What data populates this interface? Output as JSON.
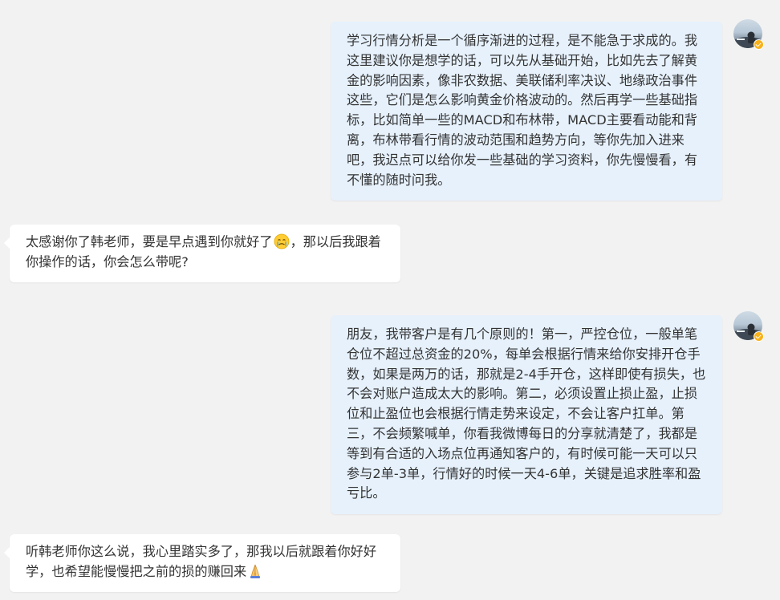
{
  "messages": [
    {
      "side": "out",
      "text": "学习行情分析是一个循序渐进的过程，是不能急于求成的。我这里建议你是想学的话，可以先从基础开始，比如先去了解黄金的影响因素，像非农数据、美联储利率决议、地缘政治事件这些，它们是怎么影响黄金价格波动的。然后再学一些基础指标，比如简单一些的MACD和布林带，MACD主要看动能和背离，布林带看行情的波动范围和趋势方向，等你先加入进来吧，我迟点可以给你发一些基础的学习资料，你先慢慢看，有不懂的随时问我。"
    },
    {
      "side": "in",
      "text_before_emoji": "太感谢你了韩老师，要是早点遇到你就好了",
      "emoji": "crying-face-icon",
      "text_after_emoji": "，那以后我跟着你操作的话，你会怎么带呢?"
    },
    {
      "side": "out",
      "text": "朋友，我带客户是有几个原则的！第一，严控仓位，一般单笔仓位不超过总资金的20%，每单会根据行情来给你安排开仓手数，如果是两万的话，那就是2-4手开仓，这样即使有损失，也不会对账户造成太大的影响。第二，必须设置止损止盈，止损位和止盈位也会根据行情走势来设定，不会让客户扛单。第三，不会频繁喊单，你看我微博每日的分享就清楚了，我都是等到有合适的入场点位再通知客户的，有时候可能一天可以只参与2单-3单，行情好的时候一天4-6单，关键是追求胜率和盈亏比。"
    },
    {
      "side": "in",
      "text_before_emoji": "听韩老师你这么说，我心里踏实多了，那我以后就跟着你好好学，也希望能慢慢把之前的损的赚回来",
      "emoji": "praying-hands-icon",
      "text_after_emoji": ""
    }
  ],
  "colors": {
    "background": "#f2f2f2",
    "outgoing_bubble": "#e6f1fc",
    "incoming_bubble": "#ffffff",
    "verified_badge": "#f8b21b"
  }
}
